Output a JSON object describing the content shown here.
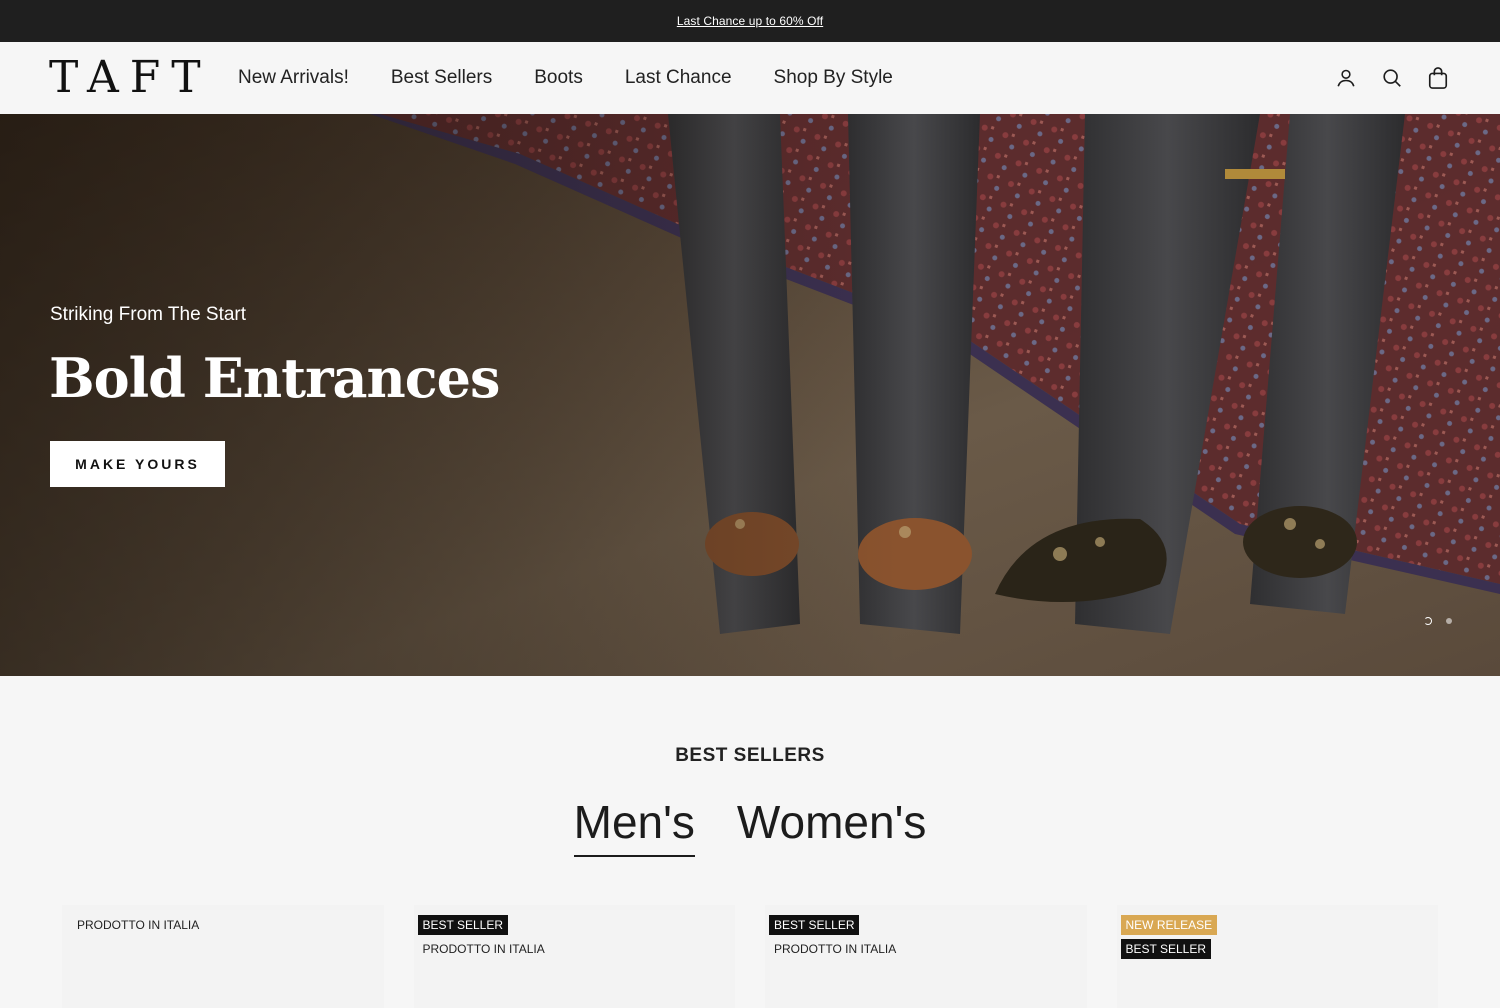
{
  "announcement": {
    "text": "Last Chance up to 60% Off"
  },
  "header": {
    "logo": "TAFT",
    "nav": [
      "New Arrivals!",
      "Best Sellers",
      "Boots",
      "Last Chance",
      "Shop By Style"
    ],
    "icons": [
      "account-icon",
      "search-icon",
      "cart-icon"
    ]
  },
  "hero": {
    "eyebrow": "Striking From The Start",
    "title": "Bold Entrances",
    "cta": "MAKE YOURS",
    "slides_total": 2,
    "active_slide": 1
  },
  "best_sellers": {
    "heading": "BEST SELLERS",
    "tabs": [
      {
        "label": "Men's",
        "active": true
      },
      {
        "label": "Women's",
        "active": false
      }
    ]
  },
  "products": [
    {
      "badges": [
        {
          "text": "PRODOTTO IN ITALIA",
          "style": "plain"
        }
      ]
    },
    {
      "badges": [
        {
          "text": "BEST SELLER",
          "style": "dark"
        },
        {
          "text": "PRODOTTO IN ITALIA",
          "style": "plain"
        }
      ]
    },
    {
      "badges": [
        {
          "text": "BEST SELLER",
          "style": "dark"
        },
        {
          "text": "PRODOTTO IN ITALIA",
          "style": "plain"
        }
      ]
    },
    {
      "badges": [
        {
          "text": "NEW RELEASE",
          "style": "gold"
        },
        {
          "text": "BEST SELLER",
          "style": "dark"
        }
      ]
    }
  ],
  "colors": {
    "announcement_bg": "#1f1f1f",
    "badge_dark": "#111111",
    "badge_gold": "#d9a853",
    "page_bg": "#f6f6f6"
  }
}
